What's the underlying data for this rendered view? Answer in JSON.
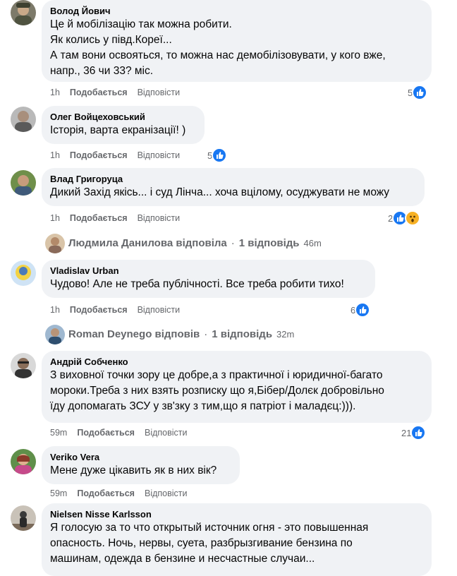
{
  "comments": [
    {
      "author": "Волод Йович",
      "text": "Це й мобілізацію так можна робити.\nЯк колись у півд.Кореї...\nА там вони освояться, то можна нас демобілізовувати, у кого вже,\nнапр., 36 чи 33? міс.",
      "time": "1h",
      "like": "Подобається",
      "reply": "Відповісти",
      "reactions": "5"
    },
    {
      "author": "Олег Войцеховський",
      "text": "Історія, варта екранізації! )",
      "time": "1h",
      "like": "Подобається",
      "reply": "Відповісти",
      "reactions": "5"
    },
    {
      "author": "Влад Григоруца",
      "text": "Дикий Захід якісь... і суд Лінча... хоча вцілому, осуджувати не можу",
      "time": "1h",
      "like": "Подобається",
      "reply": "Відповісти",
      "reactions": "2"
    },
    {
      "author": "Vladislav Urban",
      "text": "Чудово! Але не треба публічності. Все треба робити тихо!",
      "time": "1h",
      "like": "Подобається",
      "reply": "Відповісти",
      "reactions": "6"
    },
    {
      "author": "Андрій Собченко",
      "text": "З виховної точки зору це добре,а з практичної і юридичної-багато\nмороки.Треба з них взять розписку що я,Бібер/Долєк добровільно\nїду допомагать ЗСУ у зв'зку з тим,що я патріот і маладєц:))).",
      "time": "59m",
      "like": "Подобається",
      "reply": "Відповісти",
      "reactions": "21"
    },
    {
      "author": "Veriko Vera",
      "text": "Мене дуже цікавить як в них вік?",
      "time": "59m",
      "like": "Подобається",
      "reply": "Відповісти"
    },
    {
      "author": "Nielsen Nisse Karlsson",
      "text": "Я голосую за то что открытый источник огня - это повышенная\nопасность. Ночь, нервы, суета, разбрызгивание бензина по\nмашинам, одежда в бензине и несчастные случаи..."
    }
  ],
  "threads": [
    {
      "name": "Людмила Данилова відповіла",
      "sep": "·",
      "count": "1 відповідь",
      "time": "46m"
    },
    {
      "name": "Roman Deynego відповів",
      "sep": "·",
      "count": "1 відповідь",
      "time": "32m"
    }
  ],
  "colors": {
    "bubble": "#f0f2f5",
    "meta": "#65676b",
    "like_blue": "#1877f2",
    "wow": "#f7b125"
  }
}
